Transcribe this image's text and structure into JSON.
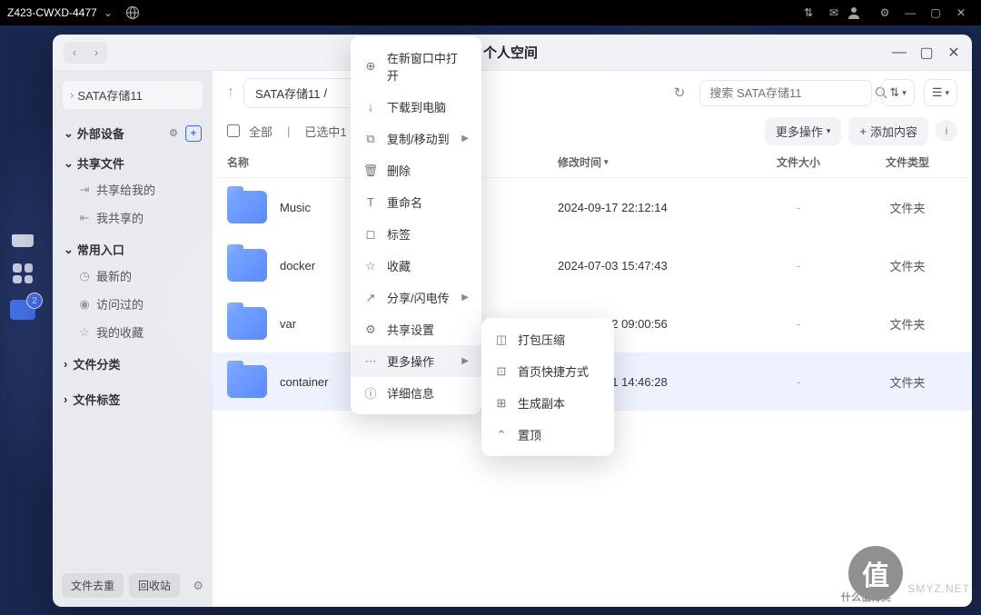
{
  "os": {
    "hostname": "Z423-CWXD-4477",
    "dock_badge": "2"
  },
  "window": {
    "title": "个人空间"
  },
  "sidebar": {
    "storage": "SATA存储11",
    "sections": {
      "external": "外部设备",
      "shared": "共享文件",
      "shared_items": [
        "共享给我的",
        "我共享的"
      ],
      "quick": "常用入口",
      "quick_items": [
        "最新的",
        "访问过的",
        "我的收藏"
      ],
      "category": "文件分类",
      "tags": "文件标签"
    },
    "footer": {
      "dedup": "文件去重",
      "trash": "回收站"
    }
  },
  "toolbar": {
    "crumb": "SATA存储11",
    "search_placeholder": "搜索 SATA存储11"
  },
  "selrow": {
    "all": "全部",
    "selected": "已选中1 |",
    "more": "更多操作",
    "add": "添加内容"
  },
  "table": {
    "cols": {
      "name": "名称",
      "mtime": "修改时间",
      "size": "文件大小",
      "type": "文件类型"
    },
    "rows": [
      {
        "name": "Music",
        "mtime": "2024-09-17 22:12:14",
        "size": "-",
        "type": "文件夹"
      },
      {
        "name": "docker",
        "mtime": "2024-07-03 15:47:43",
        "size": "-",
        "type": "文件夹"
      },
      {
        "name": "var",
        "mtime": "2024-07-02 09:00:56",
        "size": "-",
        "type": "文件夹"
      },
      {
        "name": "container",
        "mtime": "2024-07-01 14:46:28",
        "size": "-",
        "type": "文件夹",
        "selected": true
      }
    ]
  },
  "ctx1": [
    {
      "icon": "⊕",
      "label": "在新窗口中打开"
    },
    {
      "icon": "↓",
      "label": "下载到电脑"
    },
    {
      "icon": "⧉",
      "label": "复制/移动到",
      "sub": true
    },
    {
      "icon": "🗑",
      "label": "删除"
    },
    {
      "icon": "T",
      "label": "重命名"
    },
    {
      "icon": "◻",
      "label": "标签"
    },
    {
      "icon": "☆",
      "label": "收藏"
    },
    {
      "icon": "↗",
      "label": "分享/闪电传",
      "sub": true
    },
    {
      "icon": "⚙",
      "label": "共享设置"
    },
    {
      "icon": "⋯",
      "label": "更多操作",
      "sub": true,
      "hl": true
    },
    {
      "icon": "ⓘ",
      "label": "详细信息"
    }
  ],
  "ctx2": [
    {
      "icon": "◫",
      "label": "打包压缩"
    },
    {
      "icon": "⊡",
      "label": "首页快捷方式"
    },
    {
      "icon": "⊞",
      "label": "生成副本"
    },
    {
      "icon": "⌃",
      "label": "置顶"
    }
  ],
  "watermark": {
    "center": "值",
    "ring": "什么值得买",
    "site": "SMYZ.NET"
  }
}
